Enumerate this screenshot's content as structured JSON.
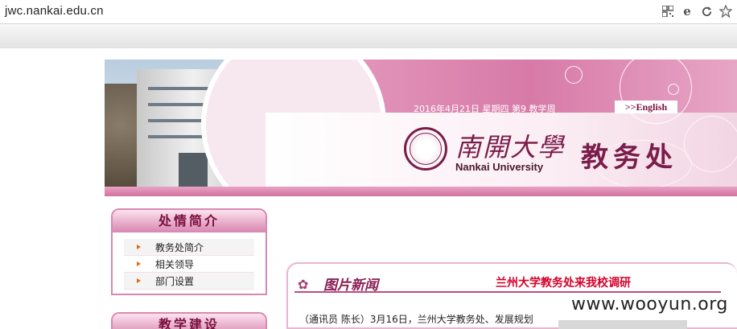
{
  "browser": {
    "url": "jwc.nankai.edu.cn",
    "icons": [
      "qr-code-icon",
      "ie-icon",
      "refresh-icon",
      "star-icon"
    ]
  },
  "banner": {
    "date_line": "2016年4月21日 星期四 第9 教学周",
    "english_link": ">>English",
    "university_cn": "南開大學",
    "university_en": "Nankai University",
    "department_cn": "教务处"
  },
  "sidebar": {
    "box1": {
      "title": "处情简介",
      "items": [
        {
          "label": "教务处简介"
        },
        {
          "label": "相关领导"
        },
        {
          "label": "部门设置"
        }
      ]
    },
    "box2": {
      "title": "教学建设"
    }
  },
  "news": {
    "section_title": "图片新闻",
    "headline": "兰州大学教务处来我校调研",
    "body_preview": "（通讯员 陈长）3月16日，兰州大学教务处、发展规划"
  },
  "watermark": "www.wooyun.org",
  "colors": {
    "accent": "#d886b0",
    "title_text": "#7a0f3f",
    "headline_red": "#d4002a"
  }
}
